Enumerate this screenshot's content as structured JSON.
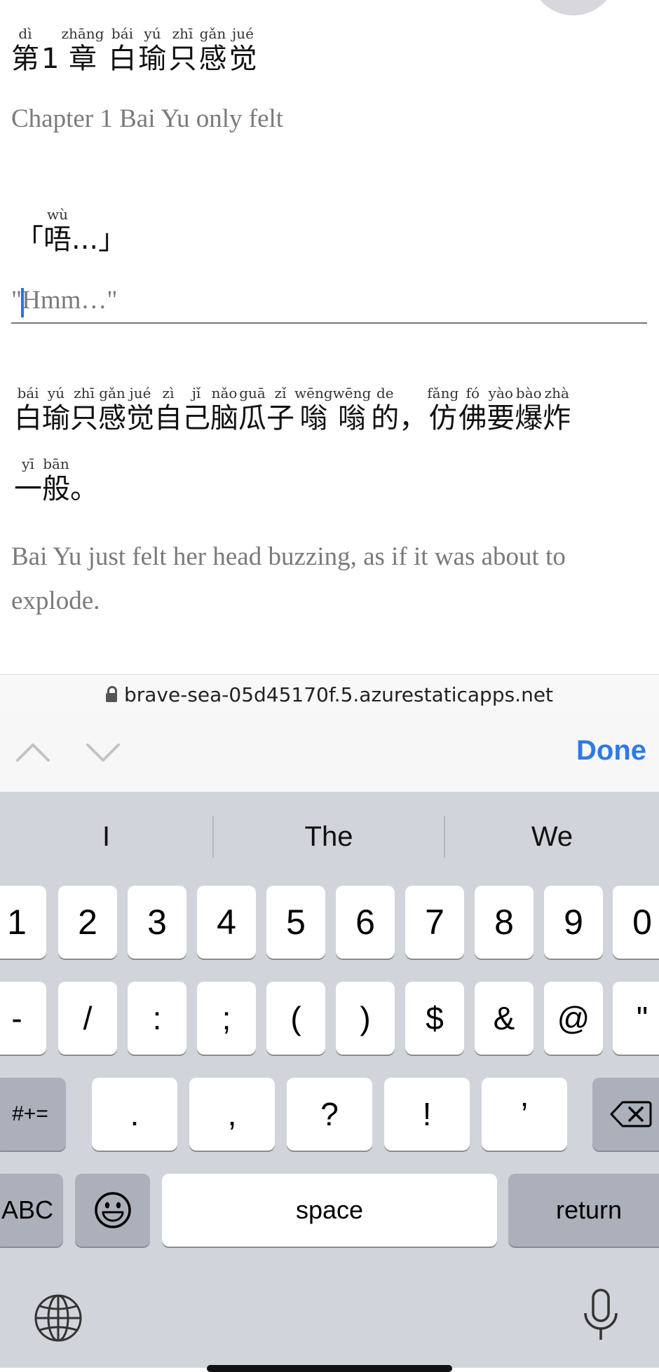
{
  "chapter": {
    "title_tokens": [
      {
        "py": "dì",
        "hz": "第"
      },
      {
        "py": "",
        "hz": "1"
      },
      {
        "py": "zhāng",
        "hz": "章"
      },
      {
        "py": "",
        "hz": " "
      },
      {
        "py": "bái",
        "hz": "白"
      },
      {
        "py": "yú",
        "hz": "瑜"
      },
      {
        "py": "zhī",
        "hz": "只"
      },
      {
        "py": "gǎn",
        "hz": "感"
      },
      {
        "py": "jué",
        "hz": "觉"
      }
    ],
    "title_translation": "Chapter 1 Bai Yu only felt"
  },
  "line1": {
    "tokens": [
      {
        "py": "",
        "hz": "「"
      },
      {
        "py": "wù",
        "hz": "唔"
      },
      {
        "py": "",
        "hz": "...」"
      }
    ],
    "translation_value": "\"Hmm…\""
  },
  "line2": {
    "row1": [
      {
        "py": "bái",
        "hz": "白"
      },
      {
        "py": "yú",
        "hz": "瑜"
      },
      {
        "py": "zhī",
        "hz": "只"
      },
      {
        "py": "gǎn",
        "hz": "感"
      },
      {
        "py": "jué",
        "hz": "觉"
      },
      {
        "py": "zì",
        "hz": "自"
      },
      {
        "py": "jǐ",
        "hz": "己"
      },
      {
        "py": "nǎo",
        "hz": "脑"
      },
      {
        "py": "guā",
        "hz": "瓜"
      },
      {
        "py": "zǐ",
        "hz": "子"
      },
      {
        "py": "wēng",
        "hz": "嗡"
      },
      {
        "py": "wēng",
        "hz": "嗡"
      },
      {
        "py": "de",
        "hz": "的"
      },
      {
        "py": "",
        "hz": "，"
      },
      {
        "py": "fǎng",
        "hz": "仿"
      },
      {
        "py": "fó",
        "hz": "佛"
      },
      {
        "py": "yào",
        "hz": "要"
      },
      {
        "py": "bào",
        "hz": "爆"
      },
      {
        "py": "zhà",
        "hz": "炸"
      }
    ],
    "row2": [
      {
        "py": "yī",
        "hz": "一"
      },
      {
        "py": "bān",
        "hz": "般"
      },
      {
        "py": "",
        "hz": "。"
      }
    ],
    "translation_line1": "Bai Yu just felt her head buzzing, as if it was about to",
    "translation_line2": "explode."
  },
  "browser": {
    "url": "brave-sea-05d45170f.5.azurestaticapps.net"
  },
  "accessory": {
    "done_label": "Done"
  },
  "keyboard": {
    "suggestions": [
      "I",
      "The",
      "We"
    ],
    "row1": [
      "1",
      "2",
      "3",
      "4",
      "5",
      "6",
      "7",
      "8",
      "9",
      "0"
    ],
    "row2": [
      "-",
      "/",
      ":",
      ";",
      "(",
      ")",
      "$",
      "&",
      "@",
      "\""
    ],
    "row3_left": "#+=",
    "row3": [
      ".",
      ",",
      "?",
      "!",
      "’"
    ],
    "abc_label": "ABC",
    "space_label": "space",
    "return_label": "return"
  },
  "icons": {
    "lock": "lock-icon",
    "chevron_up": "chevron-up-icon",
    "chevron_down": "chevron-down-icon",
    "backspace": "backspace-icon",
    "emoji": "emoji-icon",
    "globe": "globe-icon",
    "microphone": "microphone-icon"
  },
  "colors": {
    "accent": "#2f7ae5",
    "caret": "#2f6df6",
    "keyboard_bg": "#d2d4db"
  }
}
